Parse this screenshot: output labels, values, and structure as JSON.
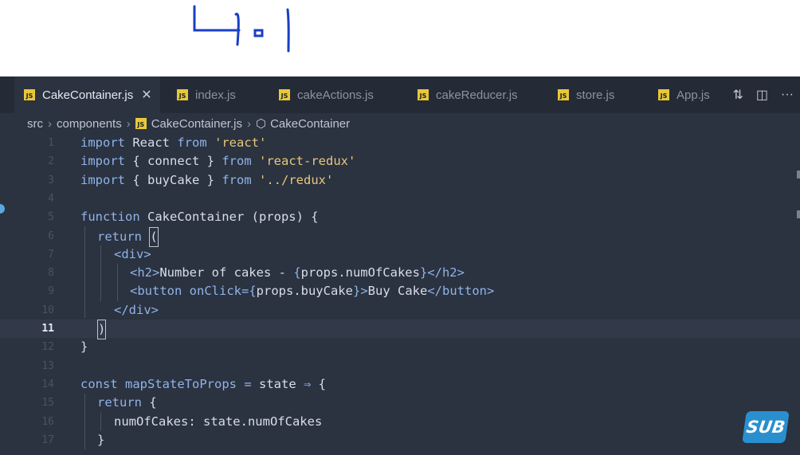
{
  "tabs": [
    {
      "label": "CakeContainer.js",
      "active": true
    },
    {
      "label": "index.js",
      "active": false
    },
    {
      "label": "cakeActions.js",
      "active": false
    },
    {
      "label": "cakeReducer.js",
      "active": false
    },
    {
      "label": "store.js",
      "active": false
    },
    {
      "label": "App.js",
      "active": false
    }
  ],
  "tab_close": "✕",
  "breadcrumb": {
    "parts": [
      "src",
      "components",
      "CakeContainer.js",
      "CakeContainer"
    ]
  },
  "code_lines": [
    {
      "n": "1"
    },
    {
      "n": "2"
    },
    {
      "n": "3"
    },
    {
      "n": "4"
    },
    {
      "n": "5"
    },
    {
      "n": "6"
    },
    {
      "n": "7"
    },
    {
      "n": "8"
    },
    {
      "n": "9"
    },
    {
      "n": "10"
    },
    {
      "n": "11"
    },
    {
      "n": "12"
    },
    {
      "n": "13"
    },
    {
      "n": "14"
    },
    {
      "n": "15"
    },
    {
      "n": "16"
    },
    {
      "n": "17"
    }
  ],
  "code": {
    "l1": {
      "a": "import",
      "b": " React ",
      "c": "from",
      "d": "'react'"
    },
    "l2": {
      "a": "import",
      "b": " { connect } ",
      "c": "from",
      "d": "'react-redux'"
    },
    "l3": {
      "a": "import",
      "b": " { buyCake } ",
      "c": "from",
      "d": "'../redux'"
    },
    "l5": {
      "a": "function",
      "b": " CakeContainer (props) {"
    },
    "l6": {
      "a": "return",
      "b": "("
    },
    "l7": {
      "a": "<div>"
    },
    "l8": {
      "a": "<h2>",
      "b": "Number of cakes - ",
      "c": "{",
      "d": "props.numOfCakes",
      "e": "}",
      "f": "</h2>"
    },
    "l9": {
      "a": "<button ",
      "b": "onClick=",
      "c": "{",
      "d": "props.buyCake",
      "e": "}",
      "f": ">",
      "g": "Buy Cake",
      "h": "</button>"
    },
    "l10": {
      "a": "</div>"
    },
    "l11": {
      "a": ")"
    },
    "l12": {
      "a": "}"
    },
    "l14": {
      "a": "const",
      "b": " mapStateToProps ",
      "c": "=",
      "d": " state ",
      "e": "⇒",
      "f": " {"
    },
    "l15": {
      "a": "return",
      "b": " {"
    },
    "l16": {
      "a": "numOfCakes: state.numOfCakes"
    },
    "l17": {
      "a": "}"
    }
  },
  "badge": "SUB",
  "colors": {
    "accent": "#2a8fce",
    "editor_bg": "#2b3240",
    "keyword": "#8fb4e8",
    "string": "#e8c87a"
  }
}
